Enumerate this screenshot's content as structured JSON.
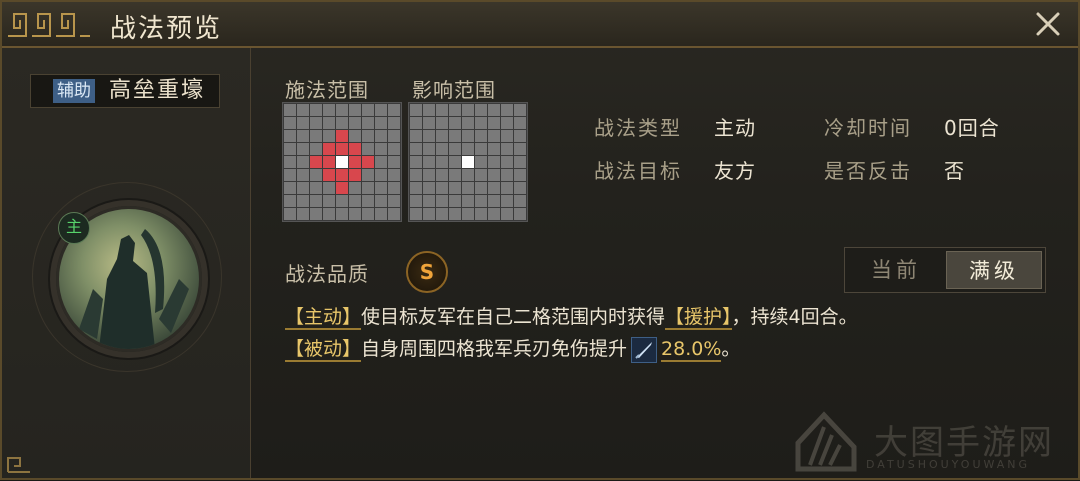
{
  "window": {
    "title": "战法预览",
    "close_icon": "close-icon"
  },
  "skill": {
    "role": "辅助",
    "name": "高垒重壕",
    "main_marker": "主"
  },
  "ranges": {
    "cast_label": "施法范围",
    "effect_label": "影响范围"
  },
  "stats": {
    "type_label": "战法类型",
    "type_value": "主动",
    "cooldown_label": "冷却时间",
    "cooldown_value": "0回合",
    "target_label": "战法目标",
    "target_value": "友方",
    "counter_label": "是否反击",
    "counter_value": "否"
  },
  "quality": {
    "label": "战法品质",
    "grade": "S",
    "badge_color": "#f0a43a"
  },
  "level_toggle": {
    "current_label": "当前",
    "max_label": "满级",
    "selected": "满级"
  },
  "description": {
    "line1_tag": "【主动】",
    "line1_text_a": "使目标友军在自己二格范围内时获得",
    "line1_buff": "【援护】",
    "line1_text_b": "，持续4回合。",
    "line2_tag": "【被动】",
    "line2_text": "自身周围四格我军兵刃免伤提升",
    "line2_icon": "sword-icon",
    "line2_value": "28.0%",
    "line2_end": "。"
  },
  "watermark": {
    "title": "大图手游网",
    "subtitle": "DATUSHOUYOUWANG"
  },
  "colors": {
    "range_cell": "#d8474d",
    "center_cell": "#ffffff",
    "empty_cell": "#7a7a7a",
    "highlight_text": "#e8c66a",
    "role_badge": "#3e5f86"
  }
}
